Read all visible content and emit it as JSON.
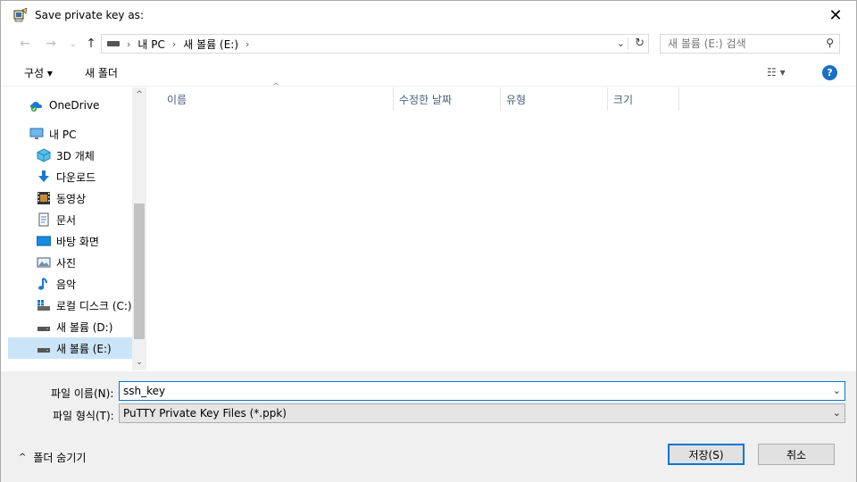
{
  "window": {
    "title": "Save private key as:",
    "close_glyph": "✕"
  },
  "nav": {
    "back_glyph": "←",
    "forward_glyph": "→",
    "recent_glyph": "⌄",
    "up_glyph": "↑",
    "breadcrumb": [
      "내 PC",
      "새 볼륨 (E:)"
    ],
    "breadcrumb_sep": "›",
    "dropdown_glyph": "⌄",
    "refresh_glyph": "↻",
    "search_placeholder": "새 볼륨 (E:) 검색",
    "search_glyph": "⚲"
  },
  "toolbar": {
    "organize_label": "구성 ▾",
    "new_folder_label": "새 폴더",
    "view_label": "☷ ▾",
    "help_label": "?"
  },
  "sidebar": {
    "items": [
      {
        "label": "OneDrive",
        "icon": "onedrive-icon"
      },
      {
        "label": "내 PC",
        "icon": "pc-icon"
      },
      {
        "label": "3D 개체",
        "icon": "3d-objects-icon"
      },
      {
        "label": "다운로드",
        "icon": "download-icon"
      },
      {
        "label": "동영상",
        "icon": "video-icon"
      },
      {
        "label": "문서",
        "icon": "document-icon"
      },
      {
        "label": "바탕 화면",
        "icon": "desktop-icon"
      },
      {
        "label": "사진",
        "icon": "picture-icon"
      },
      {
        "label": "음악",
        "icon": "music-icon"
      },
      {
        "label": "로컬 디스크 (C:)",
        "icon": "local-disk-icon"
      },
      {
        "label": "새 볼륨 (D:)",
        "icon": "drive-icon"
      },
      {
        "label": "새 볼륨 (E:)",
        "icon": "drive-icon"
      }
    ],
    "scroll_up_glyph": "^",
    "scroll_down_glyph": "⌄"
  },
  "filelist": {
    "sort_glyph": "^",
    "columns": [
      "이름",
      "수정한 날짜",
      "유형",
      "크기"
    ]
  },
  "bottom": {
    "filename_label": "파일 이름(N):",
    "filename_value": "ssh_key",
    "filetype_label": "파일 형식(T):",
    "filetype_value": "PuTTY Private Key Files (*.ppk)",
    "save_label": "저장(S)",
    "cancel_label": "취소",
    "hide_folders_label": "폴더 숨기기",
    "hide_folders_glyph": "^"
  },
  "colors": {
    "accent": "#0078d7",
    "selection": "#cce4f7",
    "help": "#1a6fc4"
  }
}
